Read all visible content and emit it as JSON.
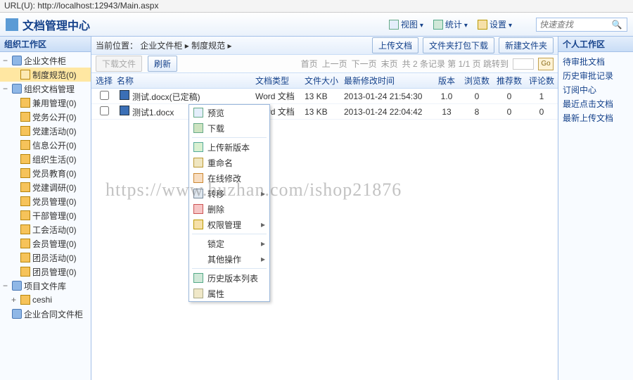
{
  "url_label": "URL(U):",
  "url": "http://localhost:12943/Main.aspx",
  "app_title": "文档管理中心",
  "header_menu": {
    "view": "视图",
    "stats": "统计",
    "settings": "设置"
  },
  "search_placeholder": "快速查找",
  "left_title": "组织工作区",
  "tree": [
    {
      "label": "企业文件柜",
      "depth": 0,
      "exp": "−",
      "icon": "db"
    },
    {
      "label": "制度规范(0)",
      "depth": 1,
      "exp": "",
      "icon": "folder-open",
      "selected": true
    },
    {
      "label": "组织文档管理",
      "depth": 0,
      "exp": "−",
      "icon": "db"
    },
    {
      "label": "兼用管理(0)",
      "depth": 1,
      "exp": "",
      "icon": "folder"
    },
    {
      "label": "党务公开(0)",
      "depth": 1,
      "exp": "",
      "icon": "folder"
    },
    {
      "label": "党建活动(0)",
      "depth": 1,
      "exp": "",
      "icon": "folder"
    },
    {
      "label": "信息公开(0)",
      "depth": 1,
      "exp": "",
      "icon": "folder"
    },
    {
      "label": "组织生活(0)",
      "depth": 1,
      "exp": "",
      "icon": "folder"
    },
    {
      "label": "党员教育(0)",
      "depth": 1,
      "exp": "",
      "icon": "folder"
    },
    {
      "label": "党建调研(0)",
      "depth": 1,
      "exp": "",
      "icon": "folder"
    },
    {
      "label": "党员管理(0)",
      "depth": 1,
      "exp": "",
      "icon": "folder"
    },
    {
      "label": "干部管理(0)",
      "depth": 1,
      "exp": "",
      "icon": "folder"
    },
    {
      "label": "工会活动(0)",
      "depth": 1,
      "exp": "",
      "icon": "folder"
    },
    {
      "label": "会员管理(0)",
      "depth": 1,
      "exp": "",
      "icon": "folder"
    },
    {
      "label": "团员活动(0)",
      "depth": 1,
      "exp": "",
      "icon": "folder"
    },
    {
      "label": "团员管理(0)",
      "depth": 1,
      "exp": "",
      "icon": "folder"
    },
    {
      "label": "项目文件库",
      "depth": 0,
      "exp": "−",
      "icon": "db"
    },
    {
      "label": "ceshi",
      "depth": 1,
      "exp": "+",
      "icon": "folder"
    },
    {
      "label": "企业合同文件柜",
      "depth": 0,
      "exp": "",
      "icon": "db"
    }
  ],
  "breadcrumb": {
    "prefix": "当前位置：",
    "a": "企业文件柜",
    "b": "制度规范",
    "sep": "▸"
  },
  "crumb_buttons": {
    "upload": "上传文档",
    "pack": "文件夹打包下载",
    "newf": "新建文件夹"
  },
  "toolbar": {
    "download": "下载文件",
    "refresh": "刷新"
  },
  "pager": {
    "first": "首页",
    "prev": "上一页",
    "next": "下一页",
    "last": "末页",
    "info": "共 2 条记录 第 1/1 页 跳转到",
    "go": "Go"
  },
  "columns": {
    "sel": "选择",
    "name": "名称",
    "type": "文档类型",
    "size": "文件大小",
    "time": "最新修改时间",
    "ver": "版本",
    "views": "浏览数",
    "rec": "推荐数",
    "comm": "评论数"
  },
  "rows": [
    {
      "name": "测试.docx(已定稿)",
      "type": "Word 文档",
      "size": "13 KB",
      "time": "2013-01-24 21:54:30",
      "ver": "1.0",
      "views": "0",
      "rec": "0",
      "comm": "1"
    },
    {
      "name": "测试1.docx",
      "type": "Word 文档",
      "size": "13 KB",
      "time": "2013-01-24 22:04:42",
      "ver": "13",
      "views": "8",
      "rec": "0",
      "comm": "0"
    }
  ],
  "right_title": "个人工作区",
  "right_items": [
    "待审批文档",
    "历史审批记录",
    "订阅中心",
    "最近点击文档",
    "最新上传文档"
  ],
  "context": {
    "preview": "预览",
    "download": "下载",
    "upload_ver": "上传新版本",
    "rename": "重命名",
    "online_edit": "在线修改",
    "move": "转移",
    "delete": "删除",
    "perm": "权限管理",
    "lock": "锁定",
    "other": "其他操作",
    "history": "历史版本列表",
    "props": "属性"
  },
  "watermark": "https://www.huzhan.com/ishop21876"
}
